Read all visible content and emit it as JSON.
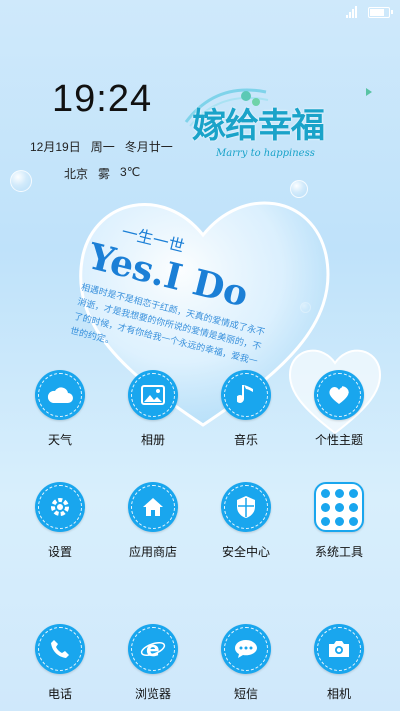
{
  "status": {
    "signal": "signal-icon",
    "battery": "battery-icon"
  },
  "lock": {
    "time": "19:24",
    "date": "12月19日",
    "weekday": "周一",
    "lunar": "冬月廿一",
    "city": "北京",
    "weather": "雾",
    "temperature": "3℃"
  },
  "wallpaper": {
    "title": "嫁给幸福",
    "subtitle": "Marry to happiness",
    "heart_line1": "一生一世",
    "heart_line2": "Yes.I Do",
    "heart_paragraph": "相遇时是不是相恋于红颜，天真的爱情成了永不消逝，才是我想要的你所说的爱情是美丽的，不了的时候，才有你给我一个永远的幸福，爱我一世的约定。"
  },
  "apps": [
    {
      "label": "天气",
      "icon": "cloud-icon"
    },
    {
      "label": "相册",
      "icon": "image-icon"
    },
    {
      "label": "音乐",
      "icon": "music-note-icon"
    },
    {
      "label": "个性主题",
      "icon": "heart-theme-icon"
    },
    {
      "label": "设置",
      "icon": "gear-icon"
    },
    {
      "label": "应用商店",
      "icon": "home-store-icon"
    },
    {
      "label": "安全中心",
      "icon": "shield-icon"
    },
    {
      "label": "系统工具",
      "icon": "grid-tools-icon"
    },
    {
      "label": "电话",
      "icon": "phone-icon"
    },
    {
      "label": "浏览器",
      "icon": "browser-e-icon"
    },
    {
      "label": "短信",
      "icon": "chat-bubble-icon"
    },
    {
      "label": "相机",
      "icon": "camera-icon"
    }
  ],
  "colors": {
    "accent": "#19a6ee",
    "background": "#cfe9fb"
  }
}
